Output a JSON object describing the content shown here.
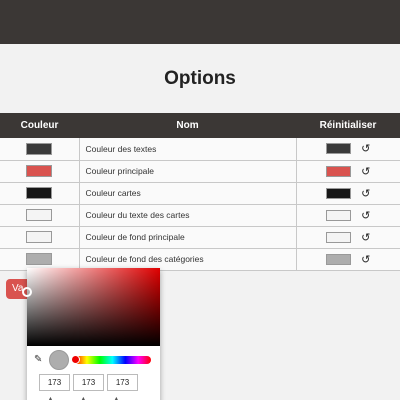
{
  "page": {
    "title": "Options"
  },
  "table": {
    "headers": {
      "color": "Couleur",
      "name": "Nom",
      "reset": "Réinitialiser"
    },
    "rows": [
      {
        "name": "Couleur des textes",
        "color": "#3a3a3a",
        "default_color": "#3a3a3a"
      },
      {
        "name": "Couleur principale",
        "color": "#d9534f",
        "default_color": "#d9534f"
      },
      {
        "name": "Couleur cartes",
        "color": "#161616",
        "default_color": "#161616"
      },
      {
        "name": "Couleur du texte des cartes",
        "color": "#f4f4f4",
        "default_color": "#f4f4f4"
      },
      {
        "name": "Couleur de fond principale",
        "color": "#f4f4f4",
        "default_color": "#f4f4f4"
      },
      {
        "name": "Couleur de fond des catégories",
        "color": "#adadad",
        "default_color": "#adadad"
      }
    ],
    "reset_icon": "reset-icon"
  },
  "validate_button": {
    "label": "Va"
  },
  "color_picker": {
    "r": "173",
    "g": "173",
    "b": "173",
    "preview_color": "#adadad",
    "eyedropper_icon": "eyedropper-icon"
  }
}
